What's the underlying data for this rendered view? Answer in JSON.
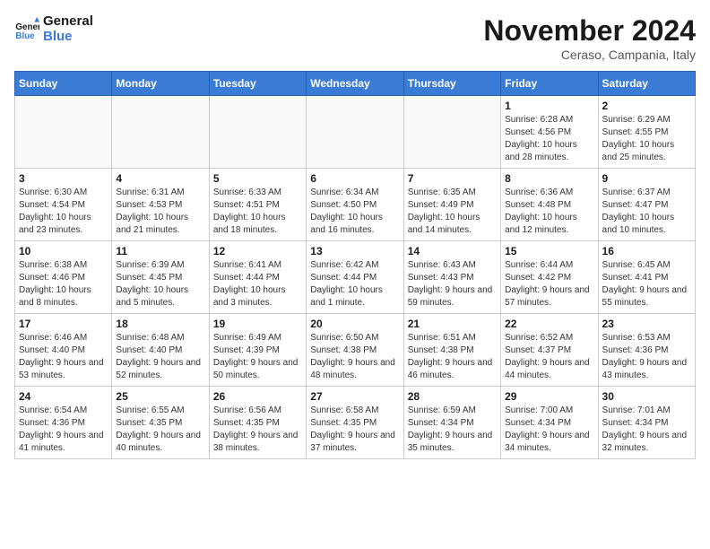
{
  "logo": {
    "line1": "General",
    "line2": "Blue"
  },
  "title": "November 2024",
  "subtitle": "Ceraso, Campania, Italy",
  "days_of_week": [
    "Sunday",
    "Monday",
    "Tuesday",
    "Wednesday",
    "Thursday",
    "Friday",
    "Saturday"
  ],
  "weeks": [
    [
      {
        "day": "",
        "info": ""
      },
      {
        "day": "",
        "info": ""
      },
      {
        "day": "",
        "info": ""
      },
      {
        "day": "",
        "info": ""
      },
      {
        "day": "",
        "info": ""
      },
      {
        "day": "1",
        "info": "Sunrise: 6:28 AM\nSunset: 4:56 PM\nDaylight: 10 hours and 28 minutes."
      },
      {
        "day": "2",
        "info": "Sunrise: 6:29 AM\nSunset: 4:55 PM\nDaylight: 10 hours and 25 minutes."
      }
    ],
    [
      {
        "day": "3",
        "info": "Sunrise: 6:30 AM\nSunset: 4:54 PM\nDaylight: 10 hours and 23 minutes."
      },
      {
        "day": "4",
        "info": "Sunrise: 6:31 AM\nSunset: 4:53 PM\nDaylight: 10 hours and 21 minutes."
      },
      {
        "day": "5",
        "info": "Sunrise: 6:33 AM\nSunset: 4:51 PM\nDaylight: 10 hours and 18 minutes."
      },
      {
        "day": "6",
        "info": "Sunrise: 6:34 AM\nSunset: 4:50 PM\nDaylight: 10 hours and 16 minutes."
      },
      {
        "day": "7",
        "info": "Sunrise: 6:35 AM\nSunset: 4:49 PM\nDaylight: 10 hours and 14 minutes."
      },
      {
        "day": "8",
        "info": "Sunrise: 6:36 AM\nSunset: 4:48 PM\nDaylight: 10 hours and 12 minutes."
      },
      {
        "day": "9",
        "info": "Sunrise: 6:37 AM\nSunset: 4:47 PM\nDaylight: 10 hours and 10 minutes."
      }
    ],
    [
      {
        "day": "10",
        "info": "Sunrise: 6:38 AM\nSunset: 4:46 PM\nDaylight: 10 hours and 8 minutes."
      },
      {
        "day": "11",
        "info": "Sunrise: 6:39 AM\nSunset: 4:45 PM\nDaylight: 10 hours and 5 minutes."
      },
      {
        "day": "12",
        "info": "Sunrise: 6:41 AM\nSunset: 4:44 PM\nDaylight: 10 hours and 3 minutes."
      },
      {
        "day": "13",
        "info": "Sunrise: 6:42 AM\nSunset: 4:44 PM\nDaylight: 10 hours and 1 minute."
      },
      {
        "day": "14",
        "info": "Sunrise: 6:43 AM\nSunset: 4:43 PM\nDaylight: 9 hours and 59 minutes."
      },
      {
        "day": "15",
        "info": "Sunrise: 6:44 AM\nSunset: 4:42 PM\nDaylight: 9 hours and 57 minutes."
      },
      {
        "day": "16",
        "info": "Sunrise: 6:45 AM\nSunset: 4:41 PM\nDaylight: 9 hours and 55 minutes."
      }
    ],
    [
      {
        "day": "17",
        "info": "Sunrise: 6:46 AM\nSunset: 4:40 PM\nDaylight: 9 hours and 53 minutes."
      },
      {
        "day": "18",
        "info": "Sunrise: 6:48 AM\nSunset: 4:40 PM\nDaylight: 9 hours and 52 minutes."
      },
      {
        "day": "19",
        "info": "Sunrise: 6:49 AM\nSunset: 4:39 PM\nDaylight: 9 hours and 50 minutes."
      },
      {
        "day": "20",
        "info": "Sunrise: 6:50 AM\nSunset: 4:38 PM\nDaylight: 9 hours and 48 minutes."
      },
      {
        "day": "21",
        "info": "Sunrise: 6:51 AM\nSunset: 4:38 PM\nDaylight: 9 hours and 46 minutes."
      },
      {
        "day": "22",
        "info": "Sunrise: 6:52 AM\nSunset: 4:37 PM\nDaylight: 9 hours and 44 minutes."
      },
      {
        "day": "23",
        "info": "Sunrise: 6:53 AM\nSunset: 4:36 PM\nDaylight: 9 hours and 43 minutes."
      }
    ],
    [
      {
        "day": "24",
        "info": "Sunrise: 6:54 AM\nSunset: 4:36 PM\nDaylight: 9 hours and 41 minutes."
      },
      {
        "day": "25",
        "info": "Sunrise: 6:55 AM\nSunset: 4:35 PM\nDaylight: 9 hours and 40 minutes."
      },
      {
        "day": "26",
        "info": "Sunrise: 6:56 AM\nSunset: 4:35 PM\nDaylight: 9 hours and 38 minutes."
      },
      {
        "day": "27",
        "info": "Sunrise: 6:58 AM\nSunset: 4:35 PM\nDaylight: 9 hours and 37 minutes."
      },
      {
        "day": "28",
        "info": "Sunrise: 6:59 AM\nSunset: 4:34 PM\nDaylight: 9 hours and 35 minutes."
      },
      {
        "day": "29",
        "info": "Sunrise: 7:00 AM\nSunset: 4:34 PM\nDaylight: 9 hours and 34 minutes."
      },
      {
        "day": "30",
        "info": "Sunrise: 7:01 AM\nSunset: 4:34 PM\nDaylight: 9 hours and 32 minutes."
      }
    ]
  ]
}
